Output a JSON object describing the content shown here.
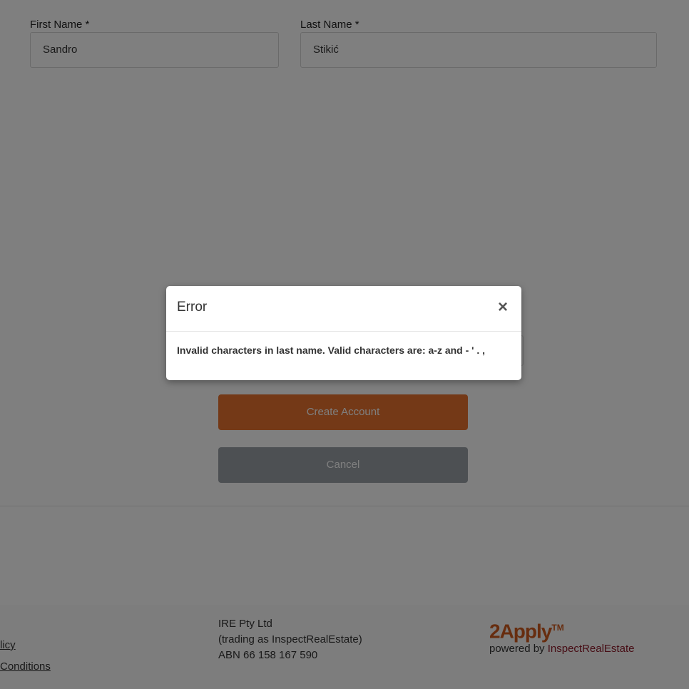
{
  "form": {
    "first_name_label": "First Name *",
    "first_name_value": "Sandro",
    "last_name_label": "Last Name *",
    "last_name_value": "Stikić",
    "create_button": "Create Account",
    "cancel_button": "Cancel"
  },
  "footer": {
    "link_privacy_partial": "licy",
    "link_terms_partial": " Conditions",
    "company_name": "IRE Pty Ltd",
    "company_trading": "(trading as InspectRealEstate)",
    "company_abn": "ABN 66 158 167 590",
    "logo_text": "2Apply",
    "logo_tm": "TM",
    "powered_by": "powered by ",
    "powered_by_brand": "InspectRealEstate"
  },
  "modal": {
    "title": "Error",
    "close_icon": "close-icon",
    "message": "Invalid characters in last name. Valid characters are: a-z and - ' . ,"
  },
  "colors": {
    "primary": "#e8732f",
    "cancel": "#9aa0a6",
    "brand_red": "#8e1b2a",
    "logo_orange": "#cf5a1e",
    "overlay": "rgba(0,0,0,0.5)"
  }
}
